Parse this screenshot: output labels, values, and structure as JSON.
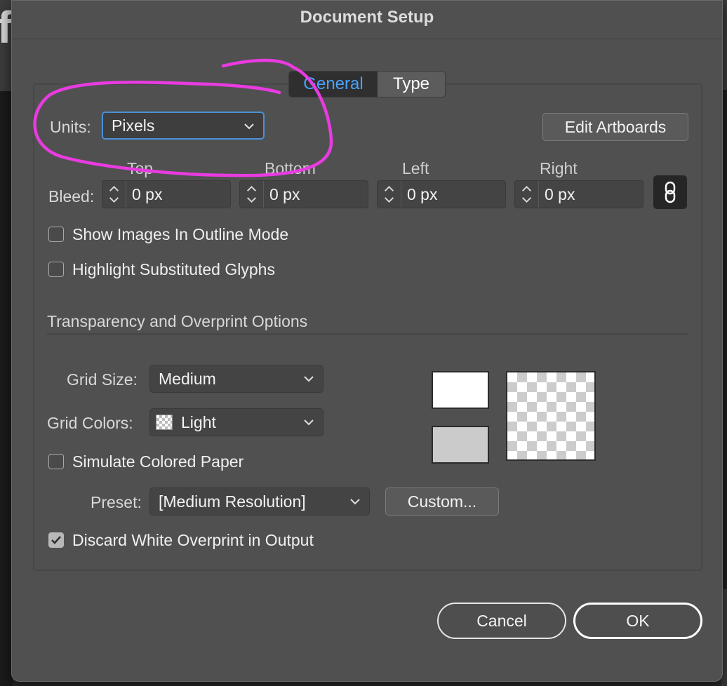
{
  "window": {
    "title": "Document Setup"
  },
  "tabs": [
    {
      "label": "General",
      "active": true
    },
    {
      "label": "Type",
      "active": false
    }
  ],
  "units": {
    "label": "Units:",
    "value": "Pixels"
  },
  "edit_artboards": {
    "label": "Edit Artboards"
  },
  "bleed": {
    "label": "Bleed:",
    "columns": [
      {
        "heading": "Top",
        "value": "0 px"
      },
      {
        "heading": "Bottom",
        "value": "0 px"
      },
      {
        "heading": "Left",
        "value": "0 px"
      },
      {
        "heading": "Right",
        "value": "0 px"
      }
    ],
    "link_icon": "chain-link-icon"
  },
  "options": {
    "show_images_outline": {
      "label": "Show Images In Outline Mode",
      "checked": false
    },
    "highlight_glyphs": {
      "label": "Highlight Substituted Glyphs",
      "checked": false
    }
  },
  "transparency": {
    "heading": "Transparency and Overprint Options",
    "grid_size": {
      "label": "Grid Size:",
      "value": "Medium"
    },
    "grid_colors": {
      "label": "Grid Colors:",
      "value": "Light"
    },
    "simulate_paper": {
      "label": "Simulate Colored Paper",
      "checked": false
    },
    "preset": {
      "label": "Preset:",
      "value": "[Medium Resolution]"
    },
    "custom_button": "Custom...",
    "discard_white": {
      "label": "Discard White Overprint in Output",
      "checked": true
    }
  },
  "footer": {
    "cancel": "Cancel",
    "ok": "OK"
  },
  "colors": {
    "accent": "#4aa3ff",
    "annotation": "#e83be0",
    "dialog_bg": "#505050"
  }
}
